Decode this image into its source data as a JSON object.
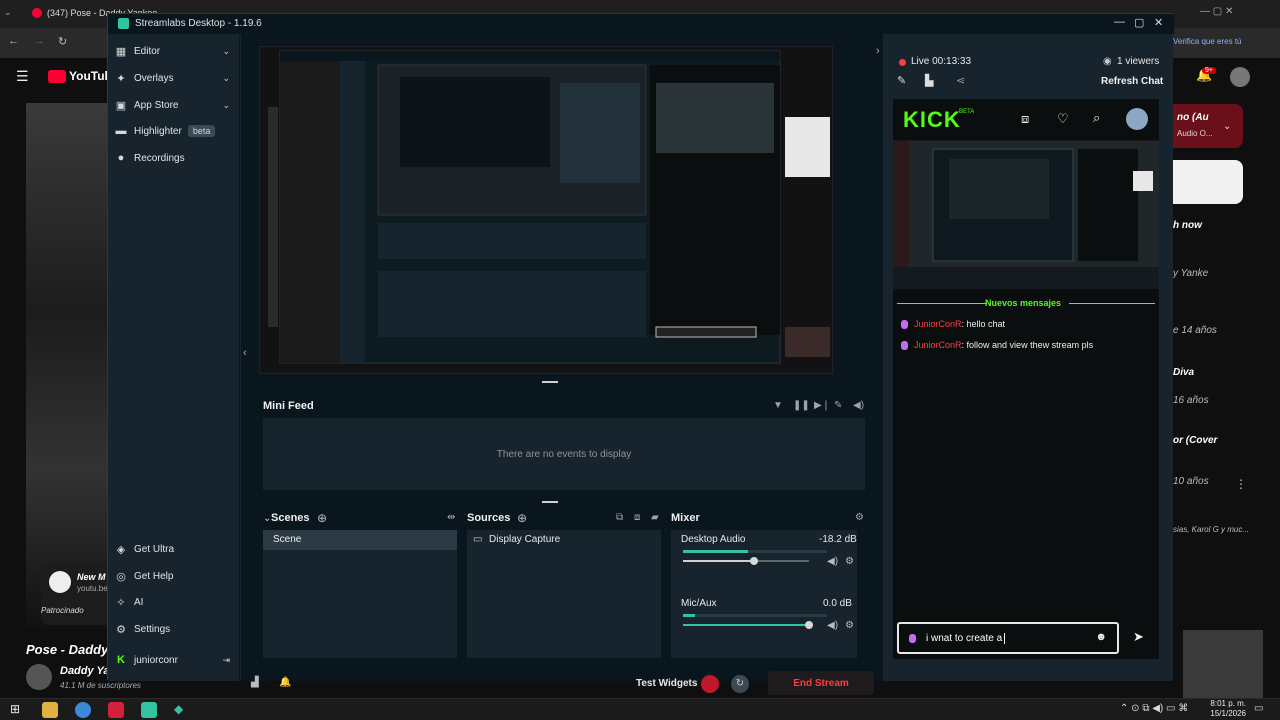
{
  "browser": {
    "tab_title": "(347) Pose - Daddy Yankee",
    "infobar_text": "Verifica que eres tú"
  },
  "youtube": {
    "logo_text": "YouTube",
    "sponsored": "Patrocinado",
    "video_title": "Pose - Daddy",
    "channel": "Daddy Yan",
    "subscribers": "41.1 M de suscriptores",
    "ad_brand": "New M",
    "ad_url": "youtu.be",
    "notification_count": "9+",
    "right_items": [
      {
        "title": "no (Au",
        "sub": "Audio O..."
      },
      {
        "title": "h now",
        "sub": ""
      },
      {
        "title": "y Yanke",
        "sub": "e 14 años"
      },
      {
        "title": "Diva",
        "sub": "16 años"
      },
      {
        "title": "or (Cover",
        "sub": "10 años"
      },
      {
        "title": "",
        "sub": "sias, Karol G y muc..."
      }
    ]
  },
  "window": {
    "title": "Streamlabs Desktop - 1.19.6"
  },
  "nav": {
    "editor": "Editor",
    "overlays": "Overlays",
    "app_store": "App Store",
    "highlighter": "Highlighter",
    "highlighter_badge": "beta",
    "recordings": "Recordings",
    "get_ultra": "Get Ultra",
    "get_help": "Get Help",
    "ai": "AI",
    "settings": "Settings",
    "user": "juniorconr"
  },
  "minifeed": {
    "title": "Mini Feed",
    "empty": "There are no events to display"
  },
  "scenes": {
    "title": "Scenes",
    "items": [
      "Scene"
    ]
  },
  "sources": {
    "title": "Sources",
    "items": [
      "Display Capture"
    ]
  },
  "mixer": {
    "title": "Mixer",
    "channels": [
      {
        "name": "Desktop Audio",
        "db": "-18.2 dB",
        "level": 0.45,
        "fader": 0.56
      },
      {
        "name": "Mic/Aux",
        "db": "0.0 dB",
        "level": 0.08,
        "fader": 1.0
      }
    ]
  },
  "bottom": {
    "test_widgets": "Test Widgets",
    "end_stream": "End Stream"
  },
  "live": {
    "status": "Live 00:13:33",
    "viewers": "1 viewers",
    "refresh": "Refresh Chat"
  },
  "kick": {
    "logo": "KICK",
    "beta": "BETA",
    "new_messages": "Nuevos mensajes",
    "messages": [
      {
        "user": "JuniorConR",
        "text": ": hello chat"
      },
      {
        "user": "JuniorConR",
        "text": ": follow and view thew stream pls"
      }
    ],
    "input_value": "i wnat to create a"
  },
  "taskbar": {
    "time": "8:01 p. m.",
    "date": "15/1/2026"
  },
  "colors": {
    "accent": "#31c3a2",
    "kick_green": "#53fc18",
    "end_stream": "#c0172a",
    "live_red": "#ff3d3d"
  }
}
